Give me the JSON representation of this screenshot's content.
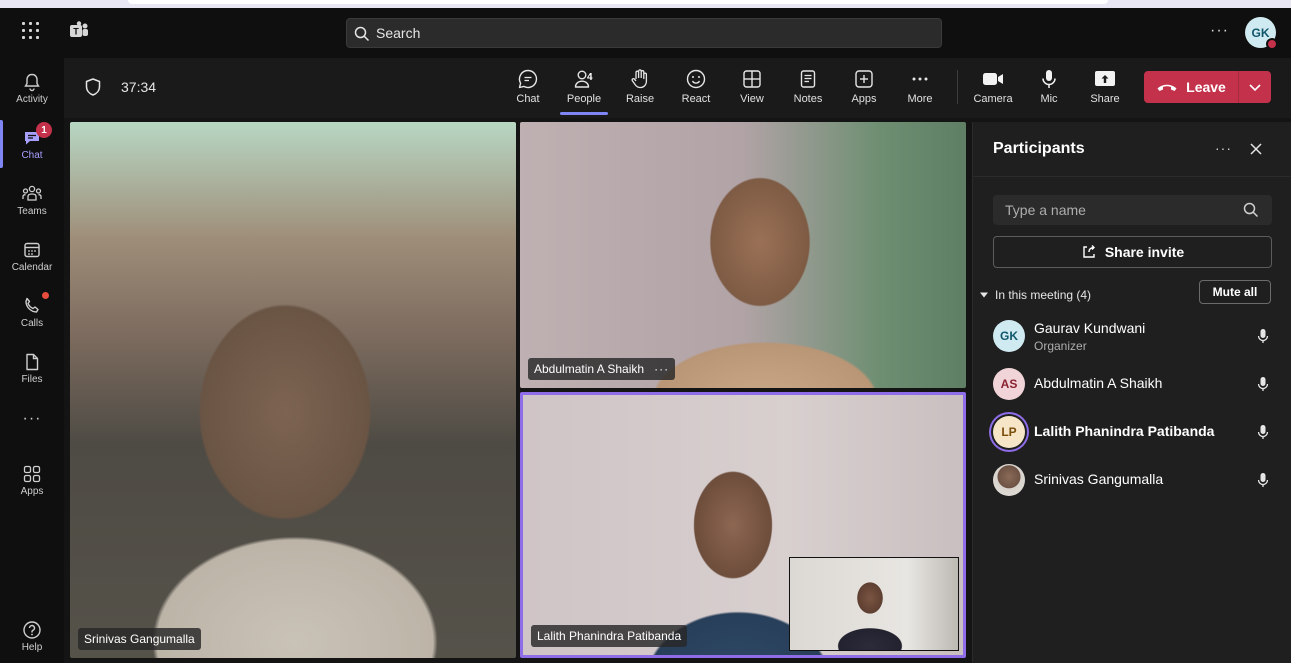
{
  "topbar": {
    "search_placeholder": "Search",
    "more": "···",
    "avatar_initials": "GK"
  },
  "rail": {
    "items": [
      {
        "label": "Activity"
      },
      {
        "label": "Chat",
        "badge": "1"
      },
      {
        "label": "Teams"
      },
      {
        "label": "Calendar"
      },
      {
        "label": "Calls"
      },
      {
        "label": "Files"
      },
      {
        "label": "···"
      },
      {
        "label": "Apps"
      },
      {
        "label": "Help"
      }
    ]
  },
  "meeting": {
    "timer": "37:34",
    "toolbar": {
      "chat": "Chat",
      "people": "People",
      "people_count": "4",
      "raise": "Raise",
      "react": "React",
      "view": "View",
      "notes": "Notes",
      "apps": "Apps",
      "more": "More",
      "camera": "Camera",
      "mic": "Mic",
      "share": "Share",
      "leave": "Leave"
    },
    "tiles": [
      {
        "name": "Srinivas Gangumalla"
      },
      {
        "name": "Abdulmatin A Shaikh",
        "more": "···"
      },
      {
        "name": "Lalith Phanindra Patibanda"
      }
    ]
  },
  "panel": {
    "title": "Participants",
    "more": "···",
    "search_placeholder": "Type a name",
    "share_invite": "Share invite",
    "section_label": "In this meeting (4)",
    "mute_all": "Mute all",
    "participants": [
      {
        "initials": "GK",
        "name": "Gaurav Kundwani",
        "role": "Organizer"
      },
      {
        "initials": "AS",
        "name": "Abdulmatin A Shaikh"
      },
      {
        "initials": "LP",
        "name": "Lalith Phanindra Patibanda"
      },
      {
        "initials": "",
        "name": "Srinivas Gangumalla"
      }
    ]
  },
  "colors": {
    "accent": "#7f85f5",
    "leave_red": "#c4314b",
    "speaker_border": "#8f6de8"
  }
}
